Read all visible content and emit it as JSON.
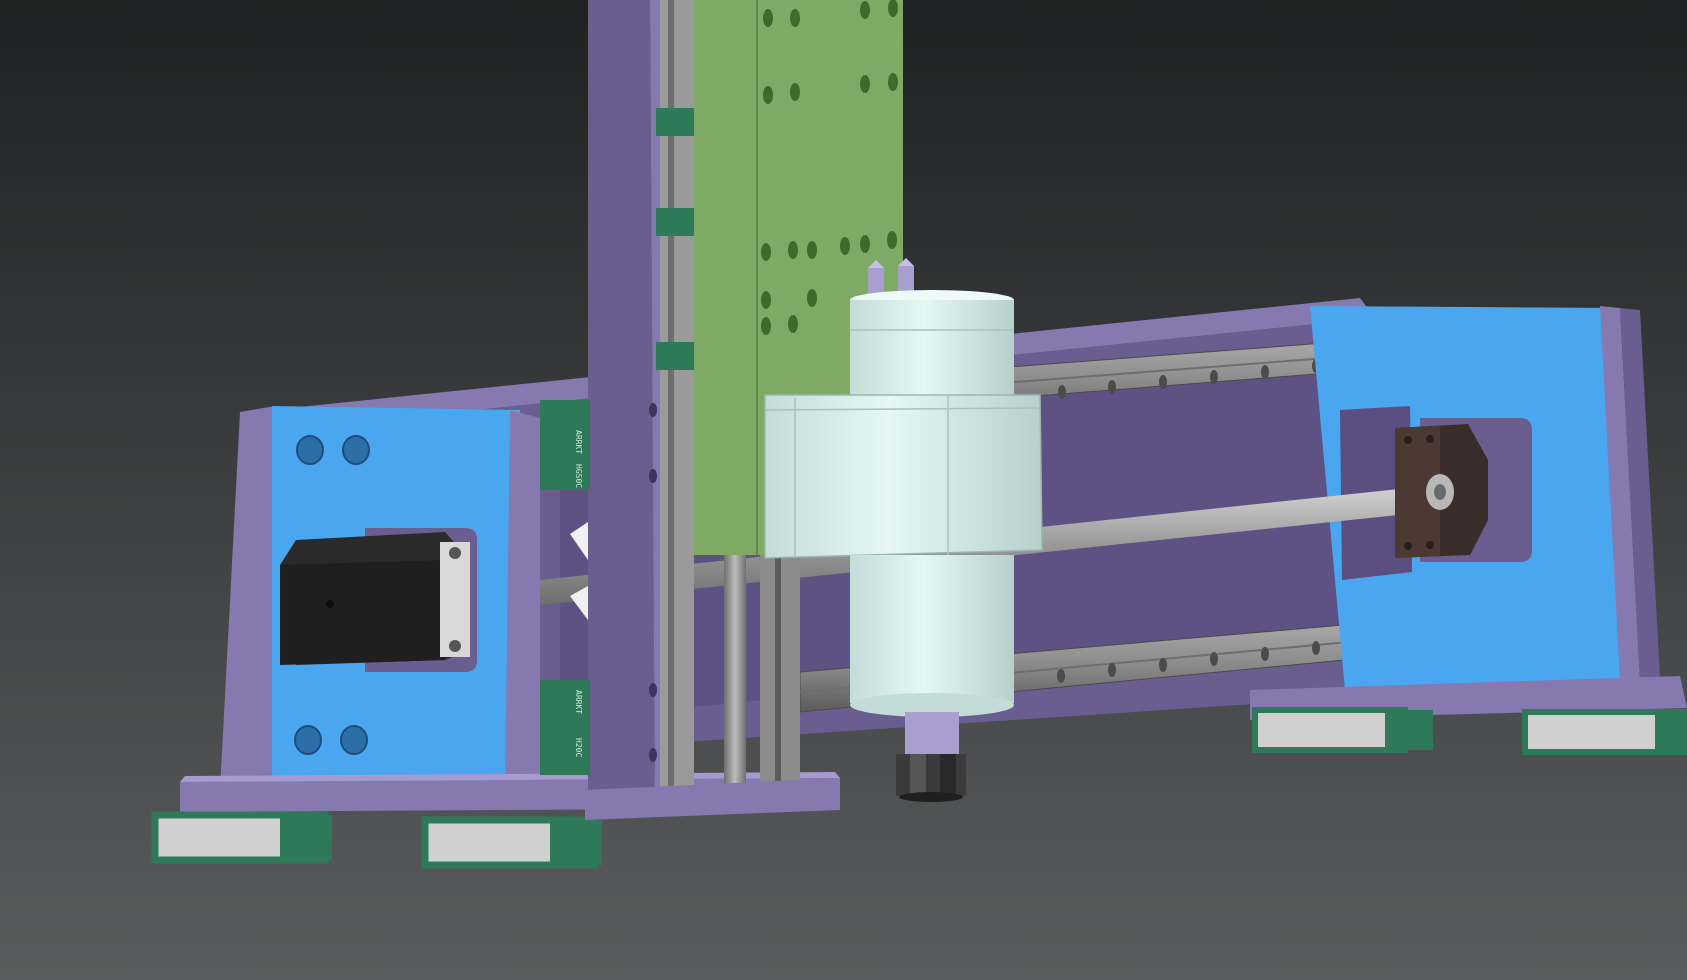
{
  "viewport": {
    "background_top": "#1f2122",
    "background_bottom": "#5a5c5d"
  },
  "colors": {
    "frame_purple": "#6a5d90",
    "frame_purple_light": "#8579b0",
    "frame_purple_dark": "#4f4573",
    "plate_blue": "#4aa6ee",
    "plate_blue_dark": "#3a86c6",
    "carriage_green": "#7faa66",
    "carriage_green_dark": "#5e8a48",
    "block_green": "#2e7a58",
    "rail_gray": "#8c8c8c",
    "rail_gray_dark": "#5c5c5c",
    "spindle_white": "#dff2ef",
    "spindle_shade": "#bcd6d2",
    "motor_black": "#2a2a2a",
    "bearing_brown": "#3a2c28",
    "rod_gray": "#a8a8a8"
  },
  "parts": {
    "rail_block_marking": "ARRKT",
    "rail_block_code": "H20C",
    "rail_block_code_alt": "HGS0C"
  }
}
